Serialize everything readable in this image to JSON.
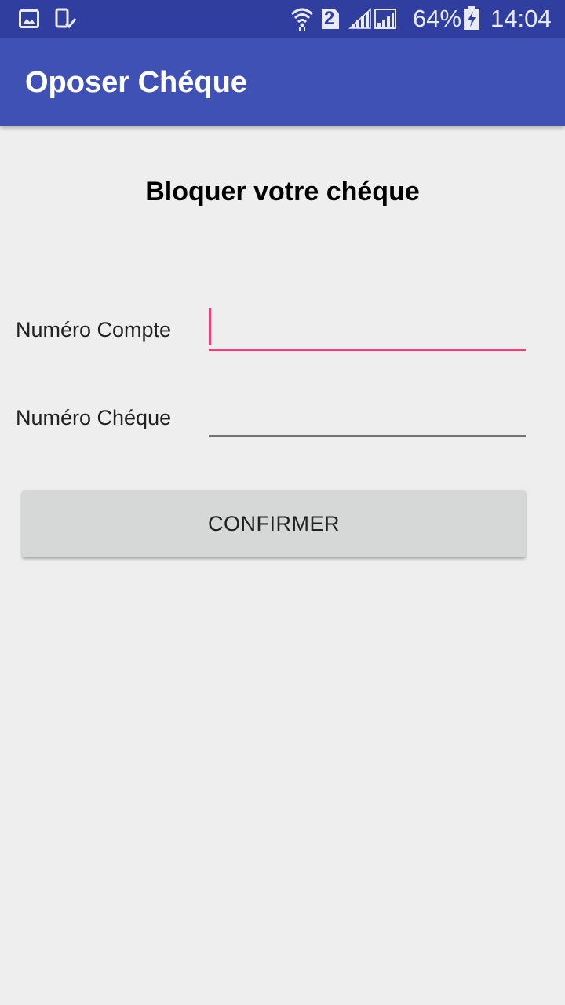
{
  "status_bar": {
    "battery_percent": "64%",
    "time": "14:04",
    "sim_badge": "2",
    "icons": [
      "gallery-icon",
      "phone-check-icon",
      "wifi-icon",
      "sim-2-icon",
      "signal-icon",
      "signal-2-icon",
      "battery-charging-icon"
    ]
  },
  "app_bar": {
    "title": "Oposer Chéque",
    "color": "#3f51b5",
    "status_color": "#303f9f"
  },
  "form": {
    "heading": "Bloquer votre chéque",
    "fields": [
      {
        "label": "Numéro Compte",
        "value": "",
        "focused": true
      },
      {
        "label": "Numéro Chéque",
        "value": "",
        "focused": false
      }
    ],
    "accent_color": "#ec407a",
    "confirm_label": "CONFIRMER"
  }
}
